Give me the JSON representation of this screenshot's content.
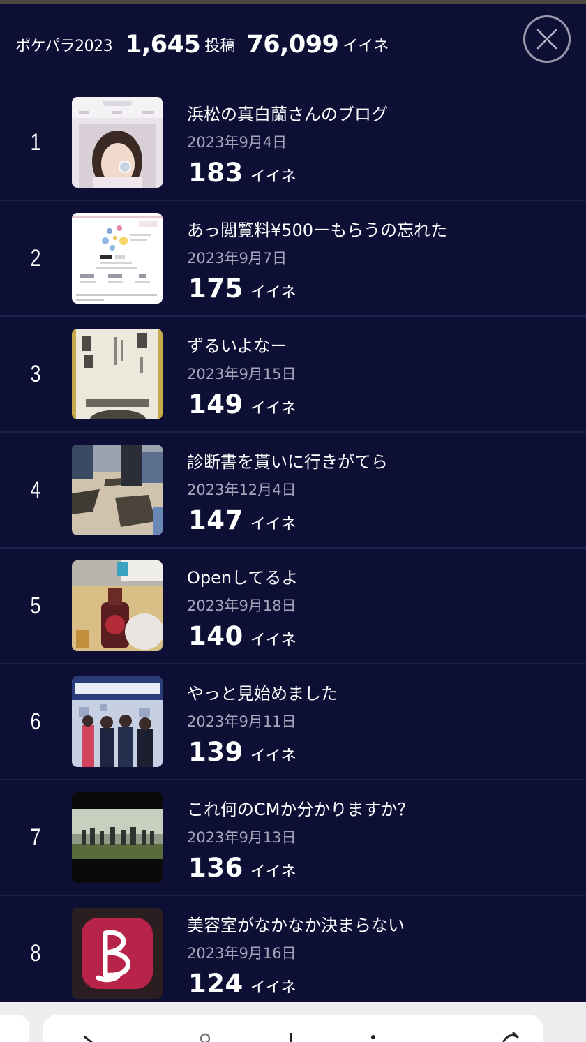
{
  "header": {
    "label": "ポケパラ2023",
    "posts_count": "1,645",
    "posts_unit": "投稿",
    "likes_count": "76,099",
    "likes_unit": "イイネ",
    "close_icon": "close-icon"
  },
  "likes_unit": "イイネ",
  "posts": [
    {
      "rank": "1",
      "title": "浜松の真白蘭さんのブログ",
      "date": "2023年9月4日",
      "likes": "183"
    },
    {
      "rank": "2",
      "title": "あっ閲覧料¥500ーもらうの忘れた",
      "date": "2023年9月7日",
      "likes": "175"
    },
    {
      "rank": "3",
      "title": "ずるいよなー",
      "date": "2023年9月15日",
      "likes": "149"
    },
    {
      "rank": "4",
      "title": "診断書を貰いに行きがてら",
      "date": "2023年12月4日",
      "likes": "147"
    },
    {
      "rank": "5",
      "title": "Openしてるよ",
      "date": "2023年9月18日",
      "likes": "140"
    },
    {
      "rank": "6",
      "title": "やっと見始めました",
      "date": "2023年9月11日",
      "likes": "139"
    },
    {
      "rank": "7",
      "title": "これ何のCMか分かりますか？",
      "date": "2023年9月13日",
      "likes": "136"
    },
    {
      "rank": "8",
      "title": "美容室がなかなか決まらない",
      "date": "2023年9月16日",
      "likes": "124"
    }
  ],
  "colors": {
    "background": "#0d0f35",
    "divider": "#1d2150",
    "date_text": "#a4a6bb",
    "close_ring": "#9a9aae"
  }
}
